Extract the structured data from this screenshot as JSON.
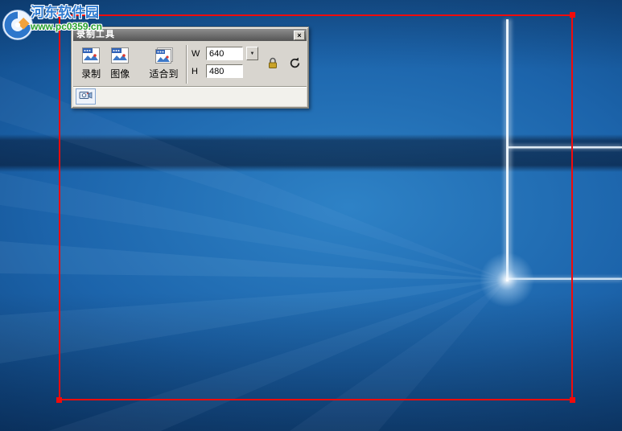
{
  "colors": {
    "selection_red": "#f10b0b",
    "desktop_blue": "#1c64ab"
  },
  "watermark": {
    "site_name": "河东软件园",
    "site_url": "www.pc0359.cn"
  },
  "recorder": {
    "title": "录制工具",
    "close_glyph": "×",
    "dropdown_glyph": "▼",
    "tools": [
      {
        "id": "record",
        "label": "录制"
      },
      {
        "id": "image",
        "label": "图像"
      },
      {
        "id": "fit-to",
        "label": "适合到"
      }
    ],
    "size": {
      "w_label": "W",
      "w_value": "640",
      "h_label": "H",
      "h_value": "480"
    }
  }
}
